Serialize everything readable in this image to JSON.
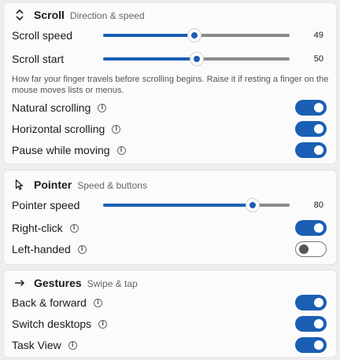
{
  "scroll": {
    "title": "Scroll",
    "subtitle": "Direction & speed",
    "icon": "up-down-arrows-icon",
    "speed_label": "Scroll speed",
    "speed_value": "49",
    "speed_level": 0.49,
    "start_label": "Scroll start",
    "start_value": "50",
    "start_level": 0.5,
    "hint": "How far your finger travels before scrolling begins. Raise it if resting a finger on the mouse moves lists or menus.",
    "toggles": [
      {
        "label": "Natural scrolling",
        "on": true
      },
      {
        "label": "Horizontal scrolling",
        "on": true
      },
      {
        "label": "Pause while moving",
        "on": true
      }
    ]
  },
  "pointer": {
    "title": "Pointer",
    "subtitle": "Speed & buttons",
    "icon": "cursor-arrow-icon",
    "speed_label": "Pointer speed",
    "speed_value": "80",
    "speed_level": 0.8,
    "toggles": [
      {
        "label": "Right-click",
        "on": true
      },
      {
        "label": "Left-handed",
        "on": false
      }
    ]
  },
  "gestures": {
    "title": "Gestures",
    "subtitle": "Swipe & tap",
    "icon": "right-arrow-icon",
    "toggles": [
      {
        "label": "Back & forward",
        "on": true
      },
      {
        "label": "Switch desktops",
        "on": true
      },
      {
        "label": "Task View",
        "on": true
      }
    ]
  },
  "colors": {
    "accent": "#1a5fb4",
    "track": "#8a8a8a",
    "card": "#fbfbfb",
    "background": "#eeeeee"
  }
}
